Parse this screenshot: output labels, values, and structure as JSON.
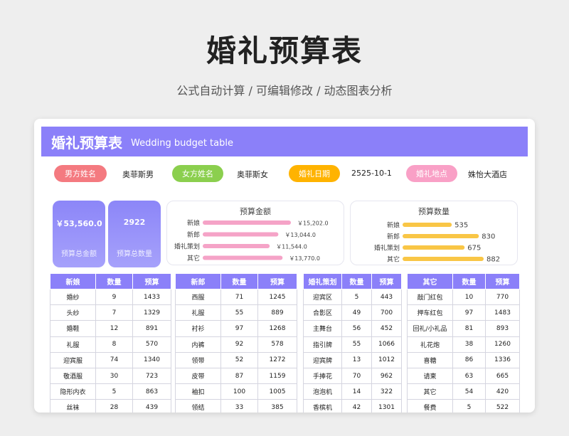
{
  "page": {
    "title": "婚礼预算表",
    "subtitle": "公式自动计算 /  可编辑修改  / 动态图表分析"
  },
  "banner": {
    "title": "婚礼预算表",
    "subtitle": "Wedding budget table",
    "color": "#8b80f9"
  },
  "info": [
    {
      "label": "男方姓名",
      "value": "奥菲斯男",
      "color": "#f47a80"
    },
    {
      "label": "女方姓名",
      "value": "奥菲斯女",
      "color": "#8bcf4e"
    },
    {
      "label": "婚礼日期",
      "value": "2525-10-1",
      "color": "#ffb300"
    },
    {
      "label": "婚礼地点",
      "value": "姝怡大酒店",
      "color": "#f9a0c6"
    }
  ],
  "stats": {
    "total_amount": "￥53,560.0",
    "total_amount_label": "预算总金额",
    "total_count": "2922",
    "total_count_label": "预算总数量"
  },
  "chart_data": [
    {
      "type": "bar",
      "orientation": "horizontal",
      "title": "预算金额",
      "categories": [
        "新娘",
        "新郎",
        "婚礼策划",
        "其它"
      ],
      "values": [
        15202.0,
        13044.0,
        11544.0,
        13770.0
      ],
      "value_labels": [
        "￥15,202.0",
        "￥13,044.0",
        "￥11,544.0",
        "￥13,770.0"
      ],
      "color": "#f5a3c7"
    },
    {
      "type": "bar",
      "orientation": "horizontal",
      "title": "预算数量",
      "categories": [
        "新娘",
        "新郎",
        "婚礼策划",
        "其它"
      ],
      "values": [
        535,
        830,
        675,
        882
      ],
      "value_labels": [
        "535",
        "830",
        "675",
        "882"
      ],
      "color": "#f9c646"
    }
  ],
  "tables": [
    {
      "headers": [
        "新娘",
        "数量",
        "预算"
      ],
      "rows": [
        [
          "婚纱",
          "9",
          "1433"
        ],
        [
          "头纱",
          "7",
          "1329"
        ],
        [
          "婚鞋",
          "12",
          "891"
        ],
        [
          "礼服",
          "8",
          "570"
        ],
        [
          "迎宾服",
          "74",
          "1340"
        ],
        [
          "敬酒服",
          "30",
          "723"
        ],
        [
          "隐形内衣",
          "5",
          "863"
        ],
        [
          "丝袜",
          "28",
          "439"
        ]
      ]
    },
    {
      "headers": [
        "新郎",
        "数量",
        "预算"
      ],
      "rows": [
        [
          "西服",
          "71",
          "1245"
        ],
        [
          "礼服",
          "55",
          "889"
        ],
        [
          "衬衫",
          "97",
          "1268"
        ],
        [
          "内裤",
          "92",
          "578"
        ],
        [
          "领带",
          "52",
          "1272"
        ],
        [
          "皮带",
          "87",
          "1159"
        ],
        [
          "袖扣",
          "100",
          "1005"
        ],
        [
          "领结",
          "33",
          "385"
        ]
      ]
    },
    {
      "headers": [
        "婚礼策划",
        "数量",
        "预算"
      ],
      "rows": [
        [
          "迎宾区",
          "5",
          "443"
        ],
        [
          "合影区",
          "49",
          "700"
        ],
        [
          "主舞台",
          "56",
          "452"
        ],
        [
          "指引牌",
          "55",
          "1066"
        ],
        [
          "迎宾牌",
          "13",
          "1012"
        ],
        [
          "手捧花",
          "70",
          "962"
        ],
        [
          "泡泡机",
          "14",
          "322"
        ],
        [
          "香槟机",
          "42",
          "1301"
        ]
      ]
    },
    {
      "headers": [
        "其它",
        "数量",
        "预算"
      ],
      "rows": [
        [
          "敲门红包",
          "10",
          "770"
        ],
        [
          "押车红包",
          "97",
          "1483"
        ],
        [
          "回礼/小礼品",
          "81",
          "893"
        ],
        [
          "礼花炮",
          "38",
          "1260"
        ],
        [
          "喜糖",
          "86",
          "1336"
        ],
        [
          "请柬",
          "63",
          "665"
        ],
        [
          "其它",
          "54",
          "420"
        ],
        [
          "餐费",
          "5",
          "522"
        ]
      ]
    }
  ]
}
